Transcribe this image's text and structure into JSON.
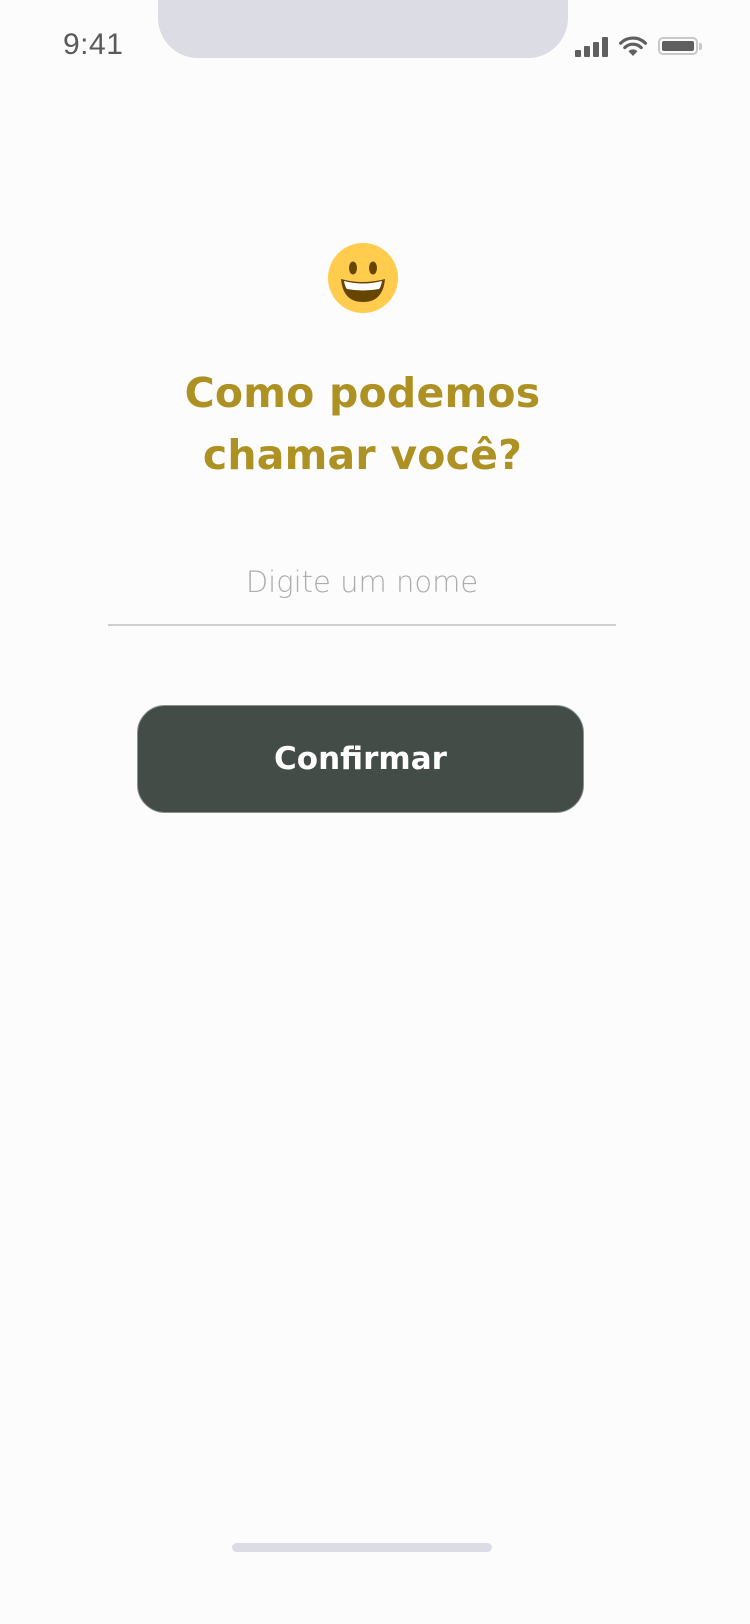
{
  "status_bar": {
    "time": "9:41",
    "icons": [
      "signal-icon",
      "wifi-icon",
      "battery-icon"
    ],
    "notch_color": "#dcdce4"
  },
  "main": {
    "emoji": "smiling-face-icon",
    "title_line1": "Como podemos",
    "title_line2": "chamar você?",
    "title_color": "#ad9122",
    "name_input": {
      "value": "",
      "placeholder": "Digite um nome"
    },
    "confirm_label": "Confirmar",
    "button_color": "#444c47"
  }
}
